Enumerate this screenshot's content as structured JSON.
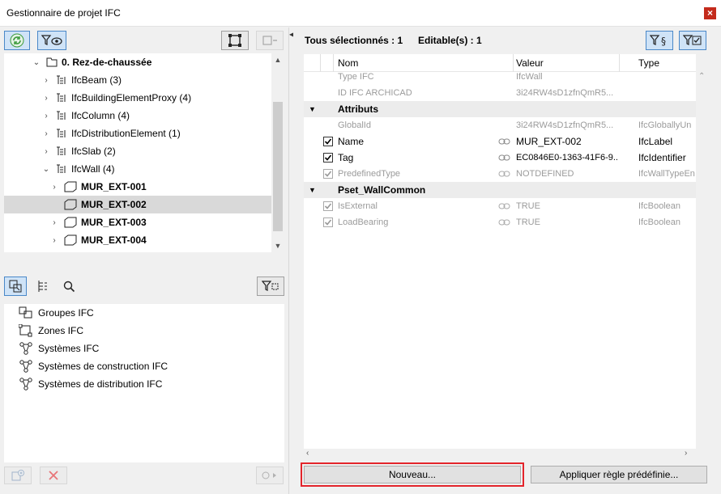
{
  "window": {
    "title": "Gestionnaire de projet IFC",
    "close_glyph": "×"
  },
  "tree": {
    "root": {
      "label": "0. Rez-de-chaussée"
    },
    "items": [
      {
        "label": "IfcBeam (3)"
      },
      {
        "label": "IfcBuildingElementProxy (4)"
      },
      {
        "label": "IfcColumn (4)"
      },
      {
        "label": "IfcDistributionElement (1)"
      },
      {
        "label": "IfcSlab (2)"
      },
      {
        "label": "IfcWall (4)"
      }
    ],
    "walls": [
      {
        "label": "MUR_EXT-001"
      },
      {
        "label": "MUR_EXT-002"
      },
      {
        "label": "MUR_EXT-003"
      },
      {
        "label": "MUR_EXT-004"
      }
    ]
  },
  "lower_list": {
    "items": [
      {
        "label": "Groupes IFC",
        "icon": "groups-icon"
      },
      {
        "label": "Zones IFC",
        "icon": "zones-icon"
      },
      {
        "label": "Systèmes IFC",
        "icon": "systems-icon"
      },
      {
        "label": "Systèmes de construction IFC",
        "icon": "systems-icon"
      },
      {
        "label": "Systèmes de distribution IFC",
        "icon": "systems-icon"
      }
    ]
  },
  "right": {
    "all_selected": "Tous sélectionnés : 1",
    "editable": "Editable(s) : 1",
    "columns": {
      "name": "Nom",
      "value": "Valeur",
      "type": "Type"
    },
    "rows": {
      "type_ifc": {
        "name": "Type IFC",
        "value": "IfcWall"
      },
      "id_ifc": {
        "name": "ID IFC ARCHICAD",
        "value": "3i24RW4sD1zfnQmR5..."
      },
      "attributs": {
        "name": "Attributs"
      },
      "globalid": {
        "name": "GlobalId",
        "value": "3i24RW4sD1zfnQmR5...",
        "type": "IfcGloballyUn"
      },
      "name": {
        "name": "Name",
        "value": "MUR_EXT-002",
        "type": "IfcLabel"
      },
      "tag": {
        "name": "Tag",
        "value": "EC0846E0-1363-41F6-9...",
        "type": "IfcIdentifier"
      },
      "predefined": {
        "name": "PredefinedType",
        "value": "NOTDEFINED",
        "type": "IfcWallTypeEn"
      },
      "pset": {
        "name": "Pset_WallCommon"
      },
      "isexternal": {
        "name": "IsExternal",
        "value": "TRUE",
        "type": "IfcBoolean"
      },
      "loadbearing": {
        "name": "LoadBearing",
        "value": "TRUE",
        "type": "IfcBoolean"
      }
    },
    "new_button": "Nouveau...",
    "apply_rule_button": "Appliquer règle prédéfinie..."
  },
  "colors": {
    "highlight": "#e3242b",
    "active_blue": "#4a88c8",
    "refresh_green": "#3a9a3a"
  }
}
